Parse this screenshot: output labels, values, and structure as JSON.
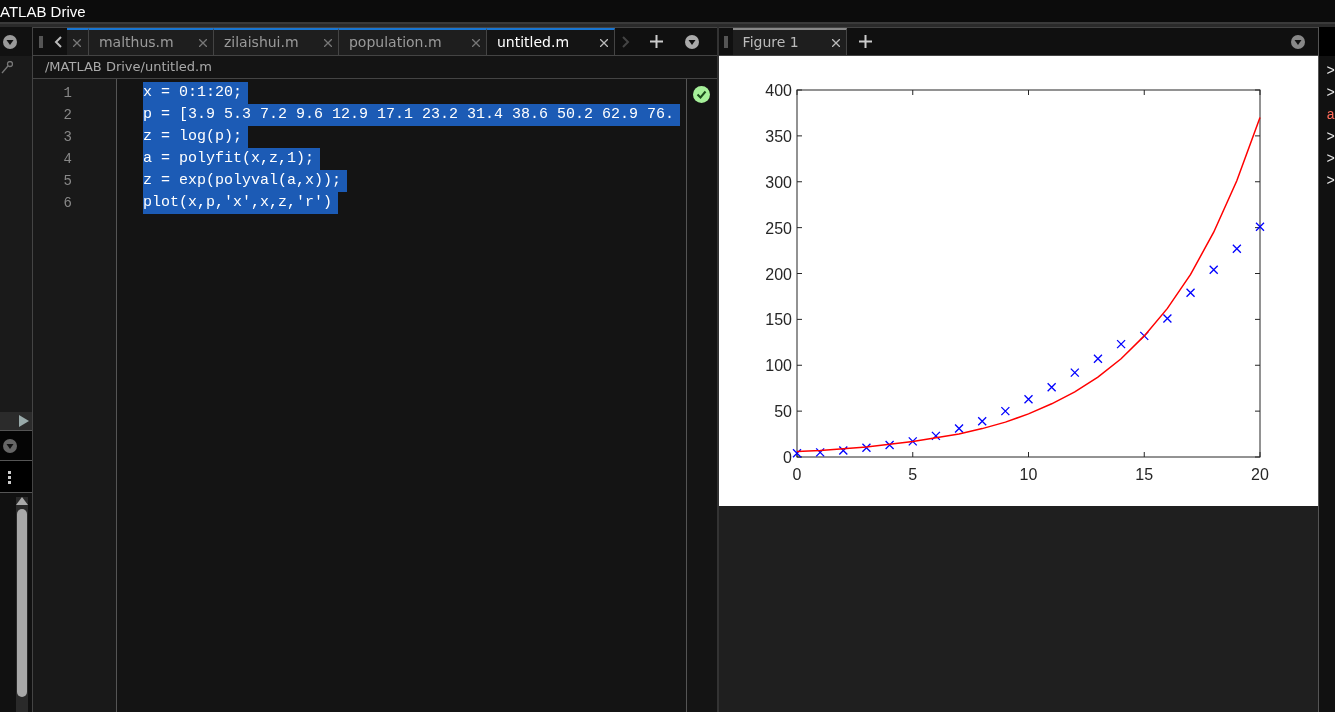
{
  "window": {
    "title": "ATLAB Drive"
  },
  "editor": {
    "tabs": [
      {
        "label": "malthus.m",
        "selected": false
      },
      {
        "label": "zilaishui.m",
        "selected": false
      },
      {
        "label": "population.m",
        "selected": false
      },
      {
        "label": "untitled.m",
        "selected": true
      }
    ],
    "path": "/MATLAB Drive/untitled.m",
    "lines": [
      {
        "number": "1",
        "code": "x = 0:1:20;",
        "selected": true
      },
      {
        "number": "2",
        "code": "p = [3.9 5.3 7.2 9.6 12.9 17.1 23.2 31.4 38.6 50.2 62.9 76.",
        "selected": true
      },
      {
        "number": "3",
        "code": "z = log(p);",
        "selected": true
      },
      {
        "number": "4",
        "code": "a = polyfit(x,z,1);",
        "selected": true
      },
      {
        "number": "5",
        "code": "z = exp(polyval(a,x));",
        "selected": true
      },
      {
        "number": "6",
        "code": "plot(x,p,'x',x,z,'r')",
        "selected": true
      }
    ]
  },
  "figure": {
    "tabs": [
      {
        "label": "Figure 1",
        "selected": true
      }
    ],
    "chart_data": {
      "type": "scatter",
      "x": [
        0,
        1,
        2,
        3,
        4,
        5,
        6,
        7,
        8,
        9,
        10,
        11,
        12,
        13,
        14,
        15,
        16,
        17,
        18,
        19,
        20
      ],
      "xlim": [
        0,
        20
      ],
      "ylim": [
        0,
        400
      ],
      "xticks": [
        0,
        5,
        10,
        15,
        20
      ],
      "yticks": [
        0,
        50,
        100,
        150,
        200,
        250,
        300,
        350,
        400
      ],
      "series": [
        {
          "marker": "cross",
          "color": "#0000ff",
          "values": [
            4,
            5,
            7,
            10,
            13,
            17,
            23,
            31,
            39,
            50,
            63,
            76,
            92,
            107,
            123,
            132,
            151,
            179,
            204,
            227,
            251
          ]
        },
        {
          "type": "line",
          "color": "#ff0000",
          "values": [
            6,
            7,
            9,
            11,
            14,
            17,
            21,
            25,
            31,
            38,
            47,
            58,
            71,
            87,
            107,
            132,
            162,
            199,
            245,
            301,
            370
          ]
        }
      ]
    }
  },
  "console": {
    "lines": [
      ">",
      ">",
      "a",
      ">",
      ">",
      ">"
    ]
  }
}
